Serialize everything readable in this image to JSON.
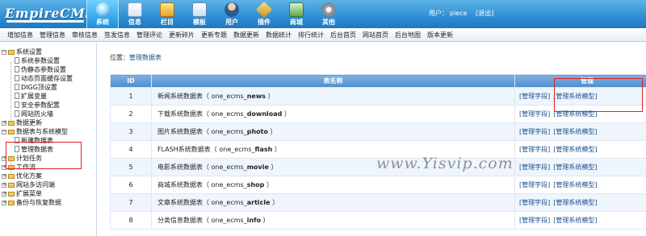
{
  "brand": {
    "logo_text": "EmpireCMS"
  },
  "topnav": [
    {
      "label": "系统",
      "icon": "globe-icon",
      "active": true
    },
    {
      "label": "信息",
      "icon": "document-icon"
    },
    {
      "label": "栏目",
      "icon": "folder-icon"
    },
    {
      "label": "模板",
      "icon": "template-icon"
    },
    {
      "label": "用户",
      "icon": "user-icon"
    },
    {
      "label": "插件",
      "icon": "plugin-icon"
    },
    {
      "label": "商城",
      "icon": "shop-icon"
    },
    {
      "label": "其他",
      "icon": "gear-icon"
    }
  ],
  "user": {
    "prefix": "用户：",
    "name": "piece",
    "logout": "[退出]"
  },
  "menubar": [
    "增加信息",
    "管理信息",
    "审核信息",
    "签发信息",
    "管理评论",
    "更新碎片",
    "更新专题",
    "数据更新",
    "数据统计",
    "排行统计",
    "后台首页",
    "网站首页",
    "后台地图",
    "版本更新"
  ],
  "tree": {
    "system_settings": "系统设置",
    "sys_params": "系统参数设置",
    "pseudo_static": "伪静态参数设置",
    "dynamic_cache": "动态页面缓存设置",
    "digg": "DIGG顶设置",
    "extend_vars": "扩展变量",
    "security": "安全参数配置",
    "firewall": "网站防火墙",
    "data_update": "数据更新",
    "datatables": "数据表与系统模型",
    "new_table": "新建数据表",
    "manage_tables": "管理数据表",
    "cron": "计划任务",
    "workflow": "工作流",
    "optimize": "优化方案",
    "multi_access": "网站多访问端",
    "ext_menu": "扩展菜单",
    "backup": "备份与恢复数据"
  },
  "crumb": {
    "prefix": "位置：",
    "link": "管理数据表"
  },
  "table": {
    "headers": {
      "id": "ID",
      "name": "表名称",
      "ops": "管理"
    },
    "op_fields": "[管理字段]",
    "op_models": "[管理系统模型]",
    "rows": [
      {
        "id": "1",
        "pre": "新闻系统数据表（ one_ecms_",
        "tbl": "news",
        "post": " ）"
      },
      {
        "id": "2",
        "pre": "下载系统数据表（ one_ecms_",
        "tbl": "download",
        "post": " ）"
      },
      {
        "id": "3",
        "pre": "图片系统数据表（ one_ecms_",
        "tbl": "photo",
        "post": " ）"
      },
      {
        "id": "4",
        "pre": "FLASH系统数据表（ one_ecms_",
        "tbl": "flash",
        "post": " ）"
      },
      {
        "id": "5",
        "pre": "电影系统数据表（ one_ecms_",
        "tbl": "movie",
        "post": " ）"
      },
      {
        "id": "6",
        "pre": "商城系统数据表（ one_ecms_",
        "tbl": "shop",
        "post": " ）"
      },
      {
        "id": "7",
        "pre": "文章系统数据表（ one_ecms_",
        "tbl": "article",
        "post": " ）"
      },
      {
        "id": "8",
        "pre": "分类信息数据表（ one_ecms_",
        "tbl": "info",
        "post": " ）"
      }
    ]
  },
  "watermark": "www.Yisvip.com",
  "colors": {
    "header_blue": "#2f8fd3",
    "highlight_red": "#e32020",
    "link_blue": "#1b4f8c"
  }
}
